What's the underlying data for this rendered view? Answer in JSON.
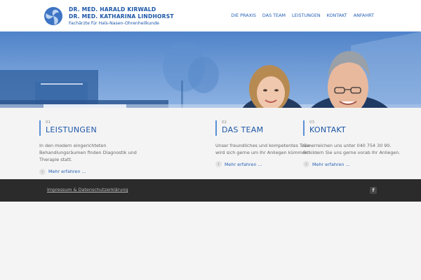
{
  "brand": {
    "line1": "Dr. med. Harald Kirwald",
    "line2": "Dr. med. Katharina Lindhorst",
    "subtitle": "Fachärzte für Hals-Nasen-Ohrenheilkunde",
    "logo_icon": "triskele-logo-icon",
    "color": "#1c56a8"
  },
  "nav": {
    "items": [
      "DIE PRAXIS",
      "DAS TEAM",
      "LEISTUNGEN",
      "KONTAKT",
      "ANFAHRT"
    ]
  },
  "hero": {
    "description_visible": "banner with two doctors"
  },
  "columns": [
    {
      "number": "01",
      "title": "LEISTUNGEN",
      "text": "In den modern eingerichteten Behandlungsräumen finden Diagnostik und Therapie statt.",
      "link": "Mehr erfahren ..."
    },
    {
      "number": "02",
      "title": "DAS TEAM",
      "text": "Unser freundliches und kompetentes Team wird sich gerne um Ihr Anliegen kümmern.",
      "link": "Mehr erfahren ..."
    },
    {
      "number": "03",
      "title": "KONTAKT",
      "text": "Sie erreichen uns unter 040 754 30 90. Schildern Sie uns gerne vorab Ihr Anliegen.",
      "link": "Mehr erfahren ..."
    }
  ],
  "footer": {
    "link": "Impressum & Datenschutzerklärung",
    "social_icon": "facebook-icon",
    "social_label": "f"
  },
  "colors": {
    "accent": "#2561b5",
    "footer_bg": "#2b2b2b",
    "page_bg": "#f4f4f4"
  }
}
